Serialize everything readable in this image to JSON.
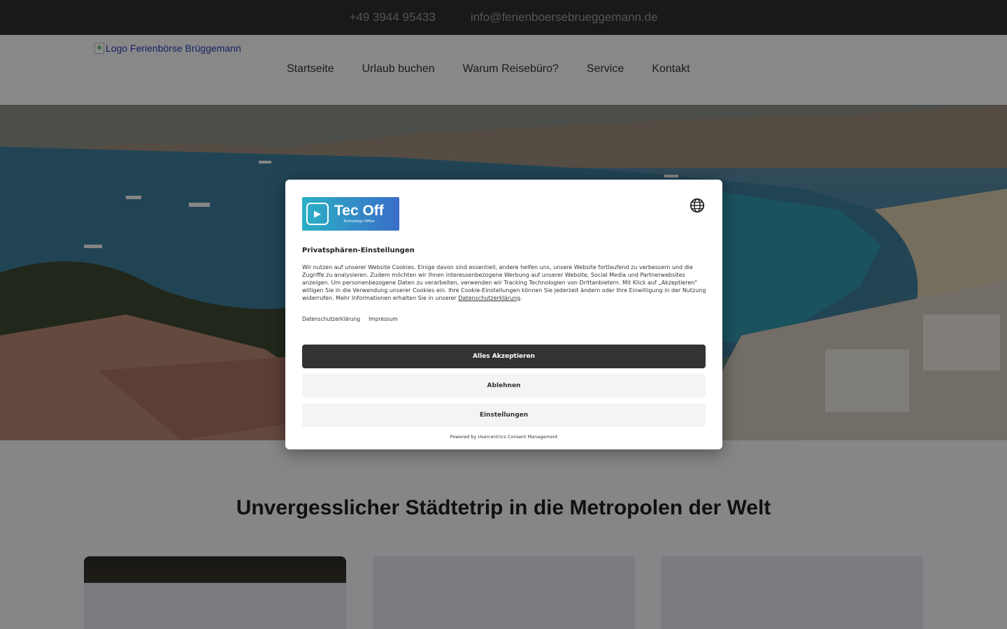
{
  "topbar": {
    "phone": "+49 3944 95433",
    "email": "info@ferienboersebrueggemann.de"
  },
  "header": {
    "logo_alt": "Logo Ferienbörse Brüggemann",
    "nav": [
      {
        "label": "Startseite"
      },
      {
        "label": "Urlaub buchen"
      },
      {
        "label": "Warum Reisebüro?"
      },
      {
        "label": "Service"
      },
      {
        "label": "Kontakt"
      }
    ]
  },
  "main": {
    "section_title": "Unvergesslicher Städtetrip in die Metropolen der Welt"
  },
  "consent": {
    "brand_name": "Tec Off",
    "brand_tagline": "Technology Office",
    "title": "Privatsphären-Einstellungen",
    "text": "Wir nutzen auf unserer Website Cookies. Einige davon sind essentiell, andere helfen uns, unsere Website fortlaufend zu verbessern und die Zugriffe zu analysieren. Zudem möchten wir Ihnen interessenbezogene Werbung auf unserer Website, Social Media und Partnerwebsites anzeigen. Um personenbezogene Daten zu verarbeiten, verwenden wir Tracking Technologien von Drittanbietern. Mit Klick auf „Akzeptieren\" willigen Sie in die Verwendung unserer Cookies ein. Ihre Cookie-Einstellungen können Sie jederzeit ändern oder Ihre Einwilligung in der Nutzung widerrufen. Mehr Informationen erhalten Sie in unserer ",
    "text_link": "Datenschutzerklärung",
    "text_end": ".",
    "links": {
      "privacy": "Datenschutzerklärung",
      "imprint": "Impressum"
    },
    "buttons": {
      "accept": "Alles Akzeptieren",
      "deny": "Ablehnen",
      "settings": "Einstellungen"
    },
    "powered_by": "Powered by Usercentrics Consent Management"
  }
}
